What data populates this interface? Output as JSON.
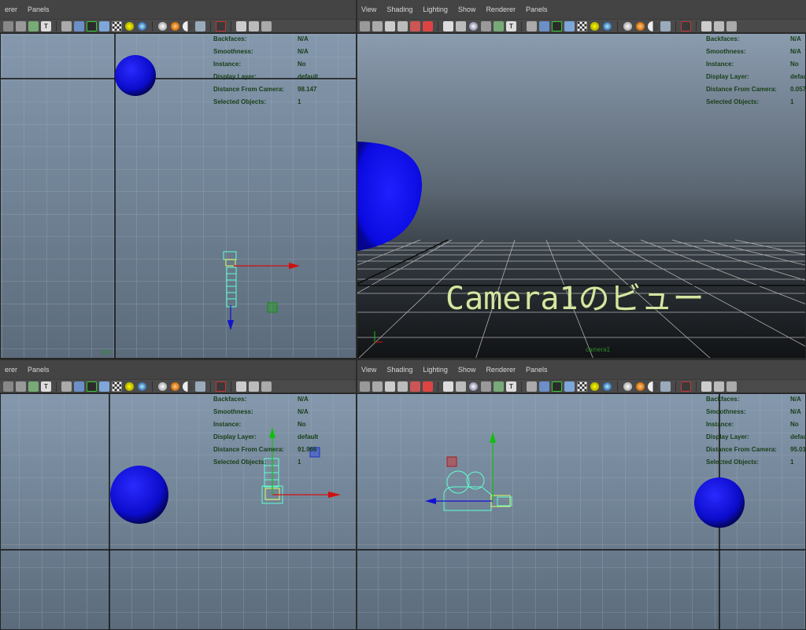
{
  "caption": "Camera1のビュー",
  "menus": {
    "top_left": [
      "erer",
      "Panels"
    ],
    "top_right": [
      "View",
      "Shading",
      "Lighting",
      "Show",
      "Renderer",
      "Panels"
    ],
    "bottom_left": [
      "erer",
      "Panels"
    ],
    "bottom_right": [
      "View",
      "Shading",
      "Lighting",
      "Show",
      "Renderer",
      "Panels"
    ]
  },
  "hud_labels": {
    "backfaces": "Backfaces:",
    "smoothness": "Smoothness:",
    "instance": "Instance:",
    "display_layer": "Display Layer:",
    "distance": "Distance From Camera:",
    "selected": "Selected Objects:"
  },
  "hud_values": {
    "top_left": {
      "backfaces": "N/A",
      "smoothness": "N/A",
      "instance": "No",
      "display_layer": "default",
      "distance": "98.147",
      "selected": "1"
    },
    "top_right": {
      "backfaces": "N/A",
      "smoothness": "N/A",
      "instance": "No",
      "display_layer": "defau",
      "distance": "0.057",
      "selected": "1"
    },
    "bottom_left": {
      "backfaces": "N/A",
      "smoothness": "N/A",
      "instance": "No",
      "display_layer": "default",
      "distance": "91.966",
      "selected": "1"
    },
    "bottom_right": {
      "backfaces": "N/A",
      "smoothness": "N/A",
      "instance": "No",
      "display_layer": "defau",
      "distance": "95.01",
      "selected": "1"
    }
  },
  "camera_labels": {
    "top_left": "top",
    "top_right": "camera1"
  },
  "colors": {
    "sphere": "#1010d0",
    "hud_text": "#173e17",
    "caption": "#d5e6a3",
    "manip_x": "#d01010",
    "manip_y": "#10c010",
    "manip_z": "#1010d0",
    "camera_wire": "#60ffd0"
  },
  "toolbar_icons": [
    "camera-icon",
    "film-icon",
    "grid-icon",
    "select-camera-icon",
    "textured-icon",
    "wireframe-icon",
    "shaded-icon",
    "light-icon",
    "shadow-icon",
    "render-icon",
    "isolate-icon"
  ]
}
